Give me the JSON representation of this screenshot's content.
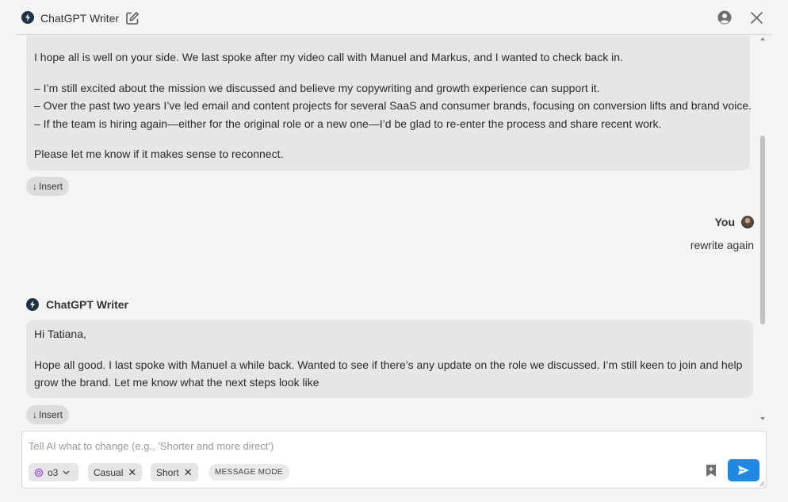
{
  "header": {
    "app_title": "ChatGPT Writer",
    "icons": {
      "logo": "bolt-logo-icon",
      "edit": "edit-icon",
      "account": "account-icon",
      "close": "close-icon"
    }
  },
  "messages": {
    "first_reply": {
      "lines": [
        "I hope all is well on your side. We last spoke after my video call with Manuel and Markus, and I wanted to check back in.",
        "– I’m still excited about the mission we discussed and believe my copywriting and growth experience can support it.",
        "– Over the past two years I’ve led email and content projects for several SaaS and consumer brands, focusing on conversion lifts and brand voice.",
        "– If the team is hiring again—either for the original role or a new one—I’d be glad to re-enter the process and share recent work.",
        "Please let me know if it makes sense to reconnect."
      ],
      "insert_label": "Insert"
    },
    "user": {
      "name": "You",
      "text": "rewrite again"
    },
    "second_reply": {
      "author": "ChatGPT Writer",
      "greeting": "Hi Tatiana,",
      "body_line1": "Hope all good. I last spoke with Manuel a while back. Wanted to see if there’s any update on the role we discussed. I’m still keen to join and help",
      "body_line2": "grow the brand. Let me know what the next steps look like",
      "insert_label": "Insert"
    }
  },
  "composer": {
    "placeholder": "Tell AI what to change (e.g., 'Shorter and more direct')",
    "model": "o3",
    "tone": "Casual",
    "length": "Short",
    "mode_label": "MESSAGE MODE"
  },
  "colors": {
    "accent": "#1e88e5",
    "bubble": "#e6e6e6",
    "background": "#f4f4f4",
    "logo": "#1c3347"
  }
}
